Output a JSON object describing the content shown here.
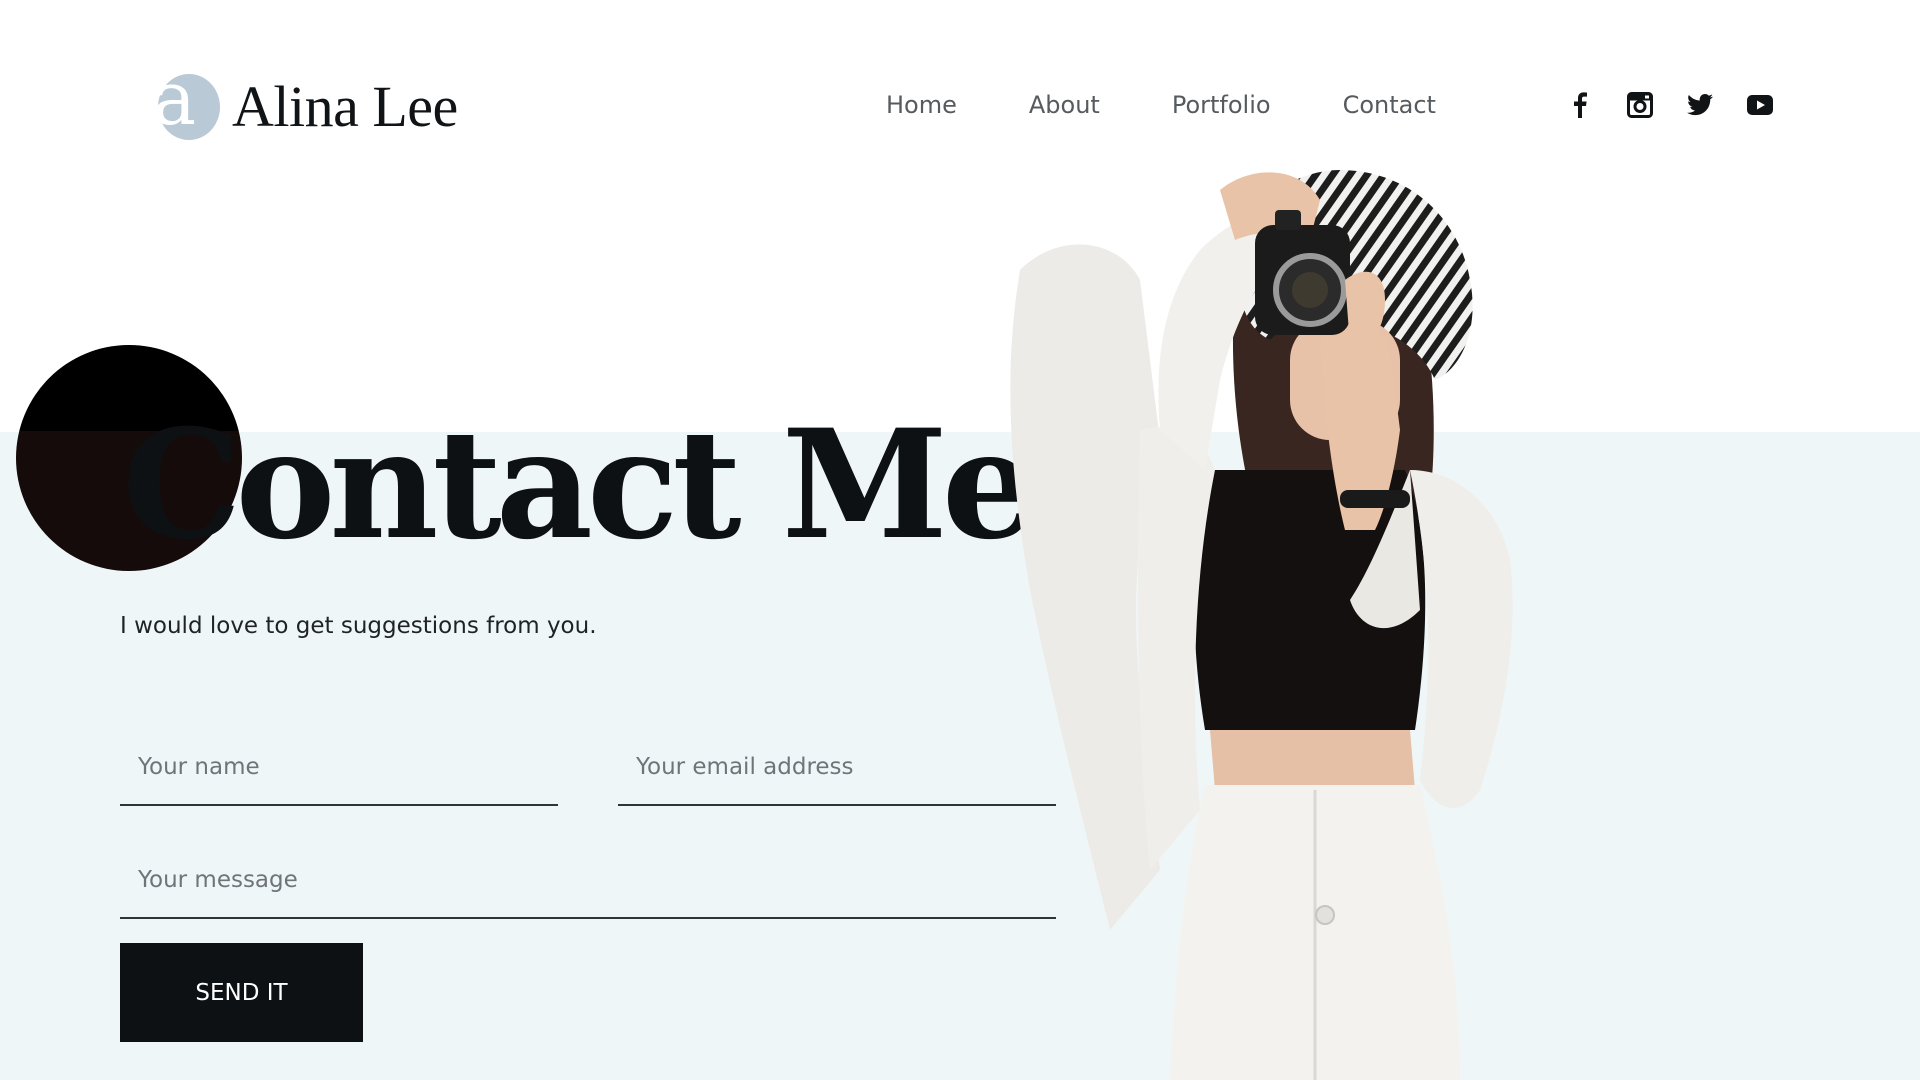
{
  "header": {
    "logo_mark": "a",
    "logo_name": "Alina Lee",
    "nav": [
      {
        "label": "Home"
      },
      {
        "label": "About"
      },
      {
        "label": "Portfolio"
      },
      {
        "label": "Contact"
      }
    ],
    "social": [
      {
        "icon": "facebook-icon"
      },
      {
        "icon": "instagram-icon"
      },
      {
        "icon": "twitter-icon"
      },
      {
        "icon": "youtube-icon"
      }
    ]
  },
  "hero": {
    "title": "Contact Me",
    "subtitle": "I would love to get suggestions from you."
  },
  "form": {
    "name_placeholder": "Your name",
    "name_value": "",
    "email_placeholder": "Your email address",
    "email_value": "",
    "message_placeholder": "Your message",
    "message_value": "",
    "submit_label": "SEND IT"
  },
  "colors": {
    "background_top": "#ffffff",
    "background_band": "#eff6f8",
    "text_dark": "#0d1114",
    "nav_text": "#565b5f",
    "logo_accent": "#b9c9d6",
    "button_bg": "#0d1114",
    "button_text": "#ffffff"
  }
}
